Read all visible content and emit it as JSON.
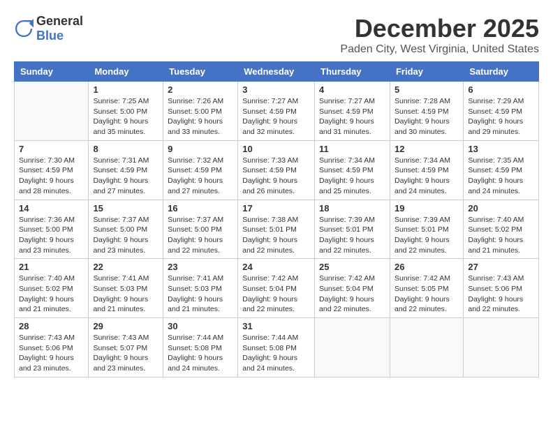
{
  "logo": {
    "general": "General",
    "blue": "Blue"
  },
  "header": {
    "month": "December 2025",
    "location": "Paden City, West Virginia, United States"
  },
  "weekdays": [
    "Sunday",
    "Monday",
    "Tuesday",
    "Wednesday",
    "Thursday",
    "Friday",
    "Saturday"
  ],
  "weeks": [
    [
      {
        "day": "",
        "info": ""
      },
      {
        "day": "1",
        "info": "Sunrise: 7:25 AM\nSunset: 5:00 PM\nDaylight: 9 hours\nand 35 minutes."
      },
      {
        "day": "2",
        "info": "Sunrise: 7:26 AM\nSunset: 5:00 PM\nDaylight: 9 hours\nand 33 minutes."
      },
      {
        "day": "3",
        "info": "Sunrise: 7:27 AM\nSunset: 4:59 PM\nDaylight: 9 hours\nand 32 minutes."
      },
      {
        "day": "4",
        "info": "Sunrise: 7:27 AM\nSunset: 4:59 PM\nDaylight: 9 hours\nand 31 minutes."
      },
      {
        "day": "5",
        "info": "Sunrise: 7:28 AM\nSunset: 4:59 PM\nDaylight: 9 hours\nand 30 minutes."
      },
      {
        "day": "6",
        "info": "Sunrise: 7:29 AM\nSunset: 4:59 PM\nDaylight: 9 hours\nand 29 minutes."
      }
    ],
    [
      {
        "day": "7",
        "info": "Sunrise: 7:30 AM\nSunset: 4:59 PM\nDaylight: 9 hours\nand 28 minutes."
      },
      {
        "day": "8",
        "info": "Sunrise: 7:31 AM\nSunset: 4:59 PM\nDaylight: 9 hours\nand 27 minutes."
      },
      {
        "day": "9",
        "info": "Sunrise: 7:32 AM\nSunset: 4:59 PM\nDaylight: 9 hours\nand 27 minutes."
      },
      {
        "day": "10",
        "info": "Sunrise: 7:33 AM\nSunset: 4:59 PM\nDaylight: 9 hours\nand 26 minutes."
      },
      {
        "day": "11",
        "info": "Sunrise: 7:34 AM\nSunset: 4:59 PM\nDaylight: 9 hours\nand 25 minutes."
      },
      {
        "day": "12",
        "info": "Sunrise: 7:34 AM\nSunset: 4:59 PM\nDaylight: 9 hours\nand 24 minutes."
      },
      {
        "day": "13",
        "info": "Sunrise: 7:35 AM\nSunset: 4:59 PM\nDaylight: 9 hours\nand 24 minutes."
      }
    ],
    [
      {
        "day": "14",
        "info": "Sunrise: 7:36 AM\nSunset: 5:00 PM\nDaylight: 9 hours\nand 23 minutes."
      },
      {
        "day": "15",
        "info": "Sunrise: 7:37 AM\nSunset: 5:00 PM\nDaylight: 9 hours\nand 23 minutes."
      },
      {
        "day": "16",
        "info": "Sunrise: 7:37 AM\nSunset: 5:00 PM\nDaylight: 9 hours\nand 22 minutes."
      },
      {
        "day": "17",
        "info": "Sunrise: 7:38 AM\nSunset: 5:01 PM\nDaylight: 9 hours\nand 22 minutes."
      },
      {
        "day": "18",
        "info": "Sunrise: 7:39 AM\nSunset: 5:01 PM\nDaylight: 9 hours\nand 22 minutes."
      },
      {
        "day": "19",
        "info": "Sunrise: 7:39 AM\nSunset: 5:01 PM\nDaylight: 9 hours\nand 22 minutes."
      },
      {
        "day": "20",
        "info": "Sunrise: 7:40 AM\nSunset: 5:02 PM\nDaylight: 9 hours\nand 21 minutes."
      }
    ],
    [
      {
        "day": "21",
        "info": "Sunrise: 7:40 AM\nSunset: 5:02 PM\nDaylight: 9 hours\nand 21 minutes."
      },
      {
        "day": "22",
        "info": "Sunrise: 7:41 AM\nSunset: 5:03 PM\nDaylight: 9 hours\nand 21 minutes."
      },
      {
        "day": "23",
        "info": "Sunrise: 7:41 AM\nSunset: 5:03 PM\nDaylight: 9 hours\nand 21 minutes."
      },
      {
        "day": "24",
        "info": "Sunrise: 7:42 AM\nSunset: 5:04 PM\nDaylight: 9 hours\nand 22 minutes."
      },
      {
        "day": "25",
        "info": "Sunrise: 7:42 AM\nSunset: 5:04 PM\nDaylight: 9 hours\nand 22 minutes."
      },
      {
        "day": "26",
        "info": "Sunrise: 7:42 AM\nSunset: 5:05 PM\nDaylight: 9 hours\nand 22 minutes."
      },
      {
        "day": "27",
        "info": "Sunrise: 7:43 AM\nSunset: 5:06 PM\nDaylight: 9 hours\nand 22 minutes."
      }
    ],
    [
      {
        "day": "28",
        "info": "Sunrise: 7:43 AM\nSunset: 5:06 PM\nDaylight: 9 hours\nand 23 minutes."
      },
      {
        "day": "29",
        "info": "Sunrise: 7:43 AM\nSunset: 5:07 PM\nDaylight: 9 hours\nand 23 minutes."
      },
      {
        "day": "30",
        "info": "Sunrise: 7:44 AM\nSunset: 5:08 PM\nDaylight: 9 hours\nand 24 minutes."
      },
      {
        "day": "31",
        "info": "Sunrise: 7:44 AM\nSunset: 5:08 PM\nDaylight: 9 hours\nand 24 minutes."
      },
      {
        "day": "",
        "info": ""
      },
      {
        "day": "",
        "info": ""
      },
      {
        "day": "",
        "info": ""
      }
    ]
  ]
}
